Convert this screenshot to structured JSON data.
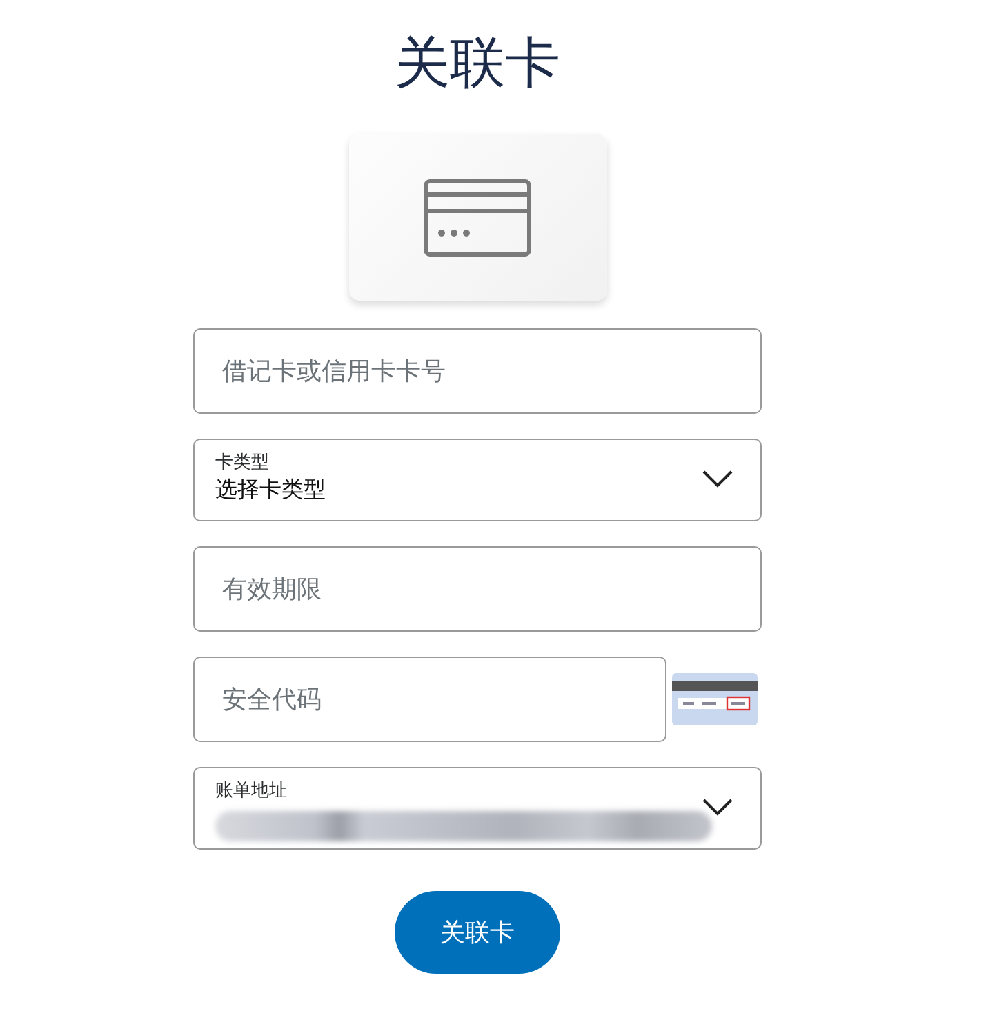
{
  "title": "关联卡",
  "fields": [
    {
      "kind": "input",
      "placeholder": "借记卡或信用卡卡号"
    },
    {
      "kind": "select",
      "label": "卡类型",
      "value": "选择卡类型"
    },
    {
      "kind": "input",
      "placeholder": "有效期限"
    },
    {
      "kind": "cvv",
      "placeholder": "安全代码"
    },
    {
      "kind": "redacted-select",
      "label": "账单地址"
    }
  ],
  "button": "关联卡"
}
